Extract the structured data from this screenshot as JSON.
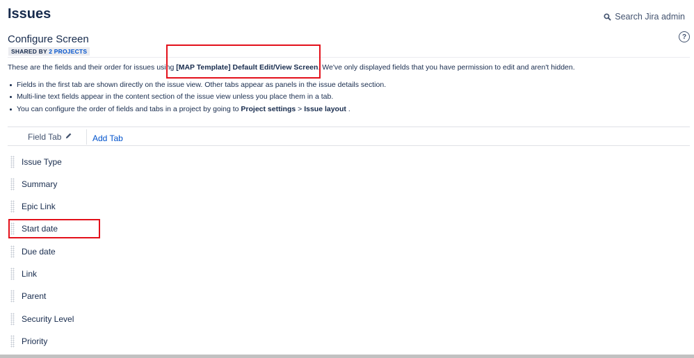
{
  "header": {
    "title": "Issues",
    "search_label": "Search Jira admin"
  },
  "screen": {
    "title": "Configure Screen",
    "shared_prefix": "SHARED BY",
    "shared_link": "2 PROJECTS",
    "help_glyph": "?"
  },
  "description": {
    "prefix": "These are the fields and their order for issues using",
    "screen_name": "[MAP Template] Default Edit/View Screen",
    "suffix": ". We've only displayed fields that you have permission to edit and aren't hidden."
  },
  "bullets": {
    "b1": "Fields in the first tab are shown directly on the issue view. Other tabs appear as panels in the issue details section.",
    "b2": "Multi-line text fields appear in the content section of the issue view unless you place them in a tab.",
    "b3_prefix": "You can configure the order of fields and tabs in a project by going to",
    "b3_bold1": "Project settings",
    "b3_sep": ">",
    "b3_bold2": "Issue layout",
    "b3_suffix": "."
  },
  "tabs": {
    "field_tab": "Field Tab",
    "add_tab": "Add Tab"
  },
  "fields": [
    "Issue Type",
    "Summary",
    "Epic Link",
    "Start date",
    "Due date",
    "Link",
    "Parent",
    "Security Level",
    "Priority"
  ],
  "colors": {
    "link": "#0052cc",
    "text": "#172b4d",
    "highlight": "#e3101a"
  },
  "icons": [
    "search-icon",
    "help-icon",
    "pencil-icon",
    "drag-handle-icon"
  ]
}
